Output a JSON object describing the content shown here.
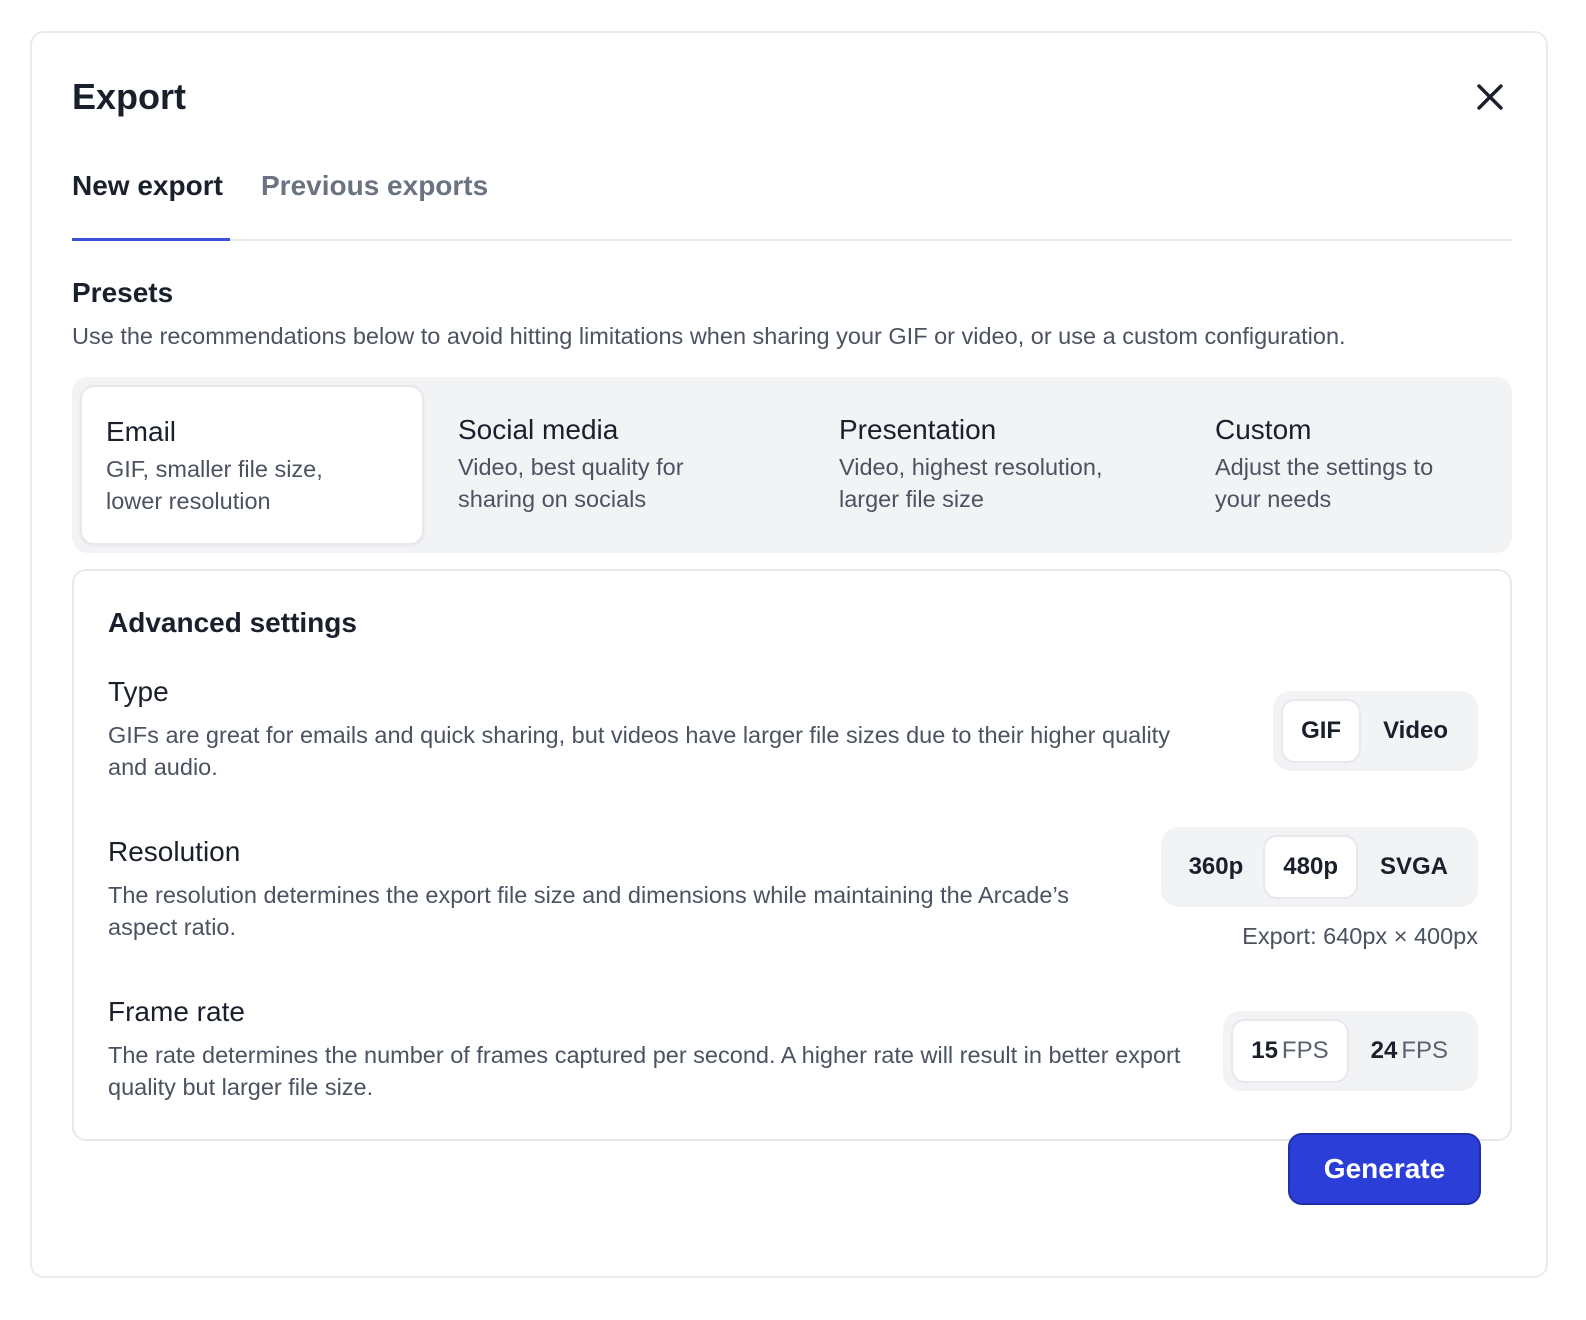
{
  "dialog": {
    "title": "Export",
    "close_icon": "close-icon"
  },
  "tabs": [
    {
      "label": "New export",
      "active": true
    },
    {
      "label": "Previous exports",
      "active": false
    }
  ],
  "presets": {
    "title": "Presets",
    "description": "Use the recommendations below to avoid hitting limitations when sharing your GIF or video, or use a custom configuration.",
    "items": [
      {
        "name": "Email",
        "description": "GIF, smaller file size, lower resolution",
        "selected": true
      },
      {
        "name": "Social media",
        "description": "Video, best quality for sharing on socials",
        "selected": false
      },
      {
        "name": "Presentation",
        "description": "Video, highest resolution, larger file size",
        "selected": false
      },
      {
        "name": "Custom",
        "description": "Adjust the settings to your needs",
        "selected": false
      }
    ]
  },
  "advanced": {
    "title": "Advanced settings",
    "type": {
      "label": "Type",
      "description": "GIFs are great for emails and quick sharing, but videos have larger file sizes due to their higher quality and audio.",
      "options": [
        "GIF",
        "Video"
      ],
      "selected": "GIF"
    },
    "resolution": {
      "label": "Resolution",
      "description": "The resolution determines the export file size and dimensions while maintaining the Arcade’s aspect ratio.",
      "options": [
        "360p",
        "480p",
        "SVGA"
      ],
      "selected": "480p",
      "export_dims": "Export: 640px × 400px"
    },
    "frame_rate": {
      "label": "Frame rate",
      "description": "The rate determines the number of frames captured per second. A higher rate will result in better export quality but larger file size.",
      "options": [
        {
          "value": "15",
          "unit": "FPS"
        },
        {
          "value": "24",
          "unit": "FPS"
        }
      ],
      "selected": "15"
    }
  },
  "footer": {
    "generate_label": "Generate"
  },
  "colors": {
    "accent": "#2b3fd8",
    "tab_underline": "#3b4fd8"
  }
}
